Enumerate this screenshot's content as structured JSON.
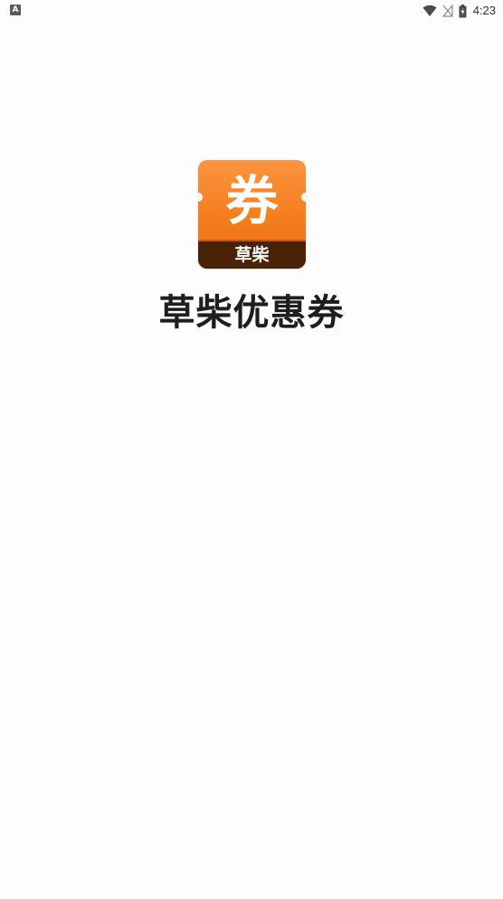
{
  "status_bar": {
    "notification_icon": "a-icon",
    "notification_glyph": "A",
    "wifi_icon": "wifi-icon",
    "signal_icon": "no-signal-icon",
    "battery_icon": "battery-charging-icon",
    "time": "4:23"
  },
  "splash": {
    "logo": {
      "main_char": "券",
      "band_text": "草柴",
      "colors": {
        "orange_top": "#fb9440",
        "orange_bottom": "#ee6f10",
        "band": "#4a2208"
      }
    },
    "app_title": "草柴优惠券"
  }
}
